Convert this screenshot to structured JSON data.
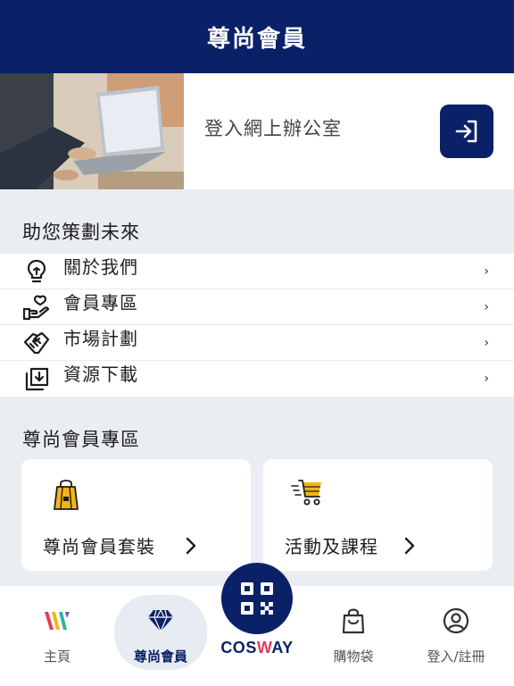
{
  "header": {
    "title": "尊尚會員"
  },
  "login": {
    "text": "登入網上辦公室",
    "icon": "login-arrow-icon"
  },
  "plan_section": {
    "title": "助您策劃未來",
    "items": [
      {
        "label": "關於我們",
        "icon": "lightbulb-icon"
      },
      {
        "label": "會員專區",
        "icon": "heart-hand-icon"
      },
      {
        "label": "市場計劃",
        "icon": "handshake-icon"
      },
      {
        "label": "資源下載",
        "icon": "download-tray-icon"
      }
    ],
    "chevron": "›"
  },
  "vip_section": {
    "title": "尊尚會員專區",
    "cards": [
      {
        "label": "尊尚會員套裝",
        "icon": "shopping-bag-icon"
      },
      {
        "label": "活動及課程",
        "icon": "fast-cart-icon"
      }
    ]
  },
  "tabbar": {
    "tabs": [
      {
        "label": "主頁",
        "icon": "w-logo-icon"
      },
      {
        "label": "尊尚會員",
        "icon": "diamond-icon",
        "active": true
      },
      {
        "label": "購物袋",
        "icon": "bag-icon"
      },
      {
        "label": "登入/註冊",
        "icon": "user-circle-icon"
      }
    ],
    "center": {
      "brand_part1": "COS",
      "brand_part2": "W",
      "brand_part3": "AY",
      "icon": "qr-code-icon"
    }
  },
  "colors": {
    "primary": "#0a2167",
    "background": "#eaedf2",
    "accent_yellow": "#f2b418",
    "accent_red": "#e63a55"
  }
}
